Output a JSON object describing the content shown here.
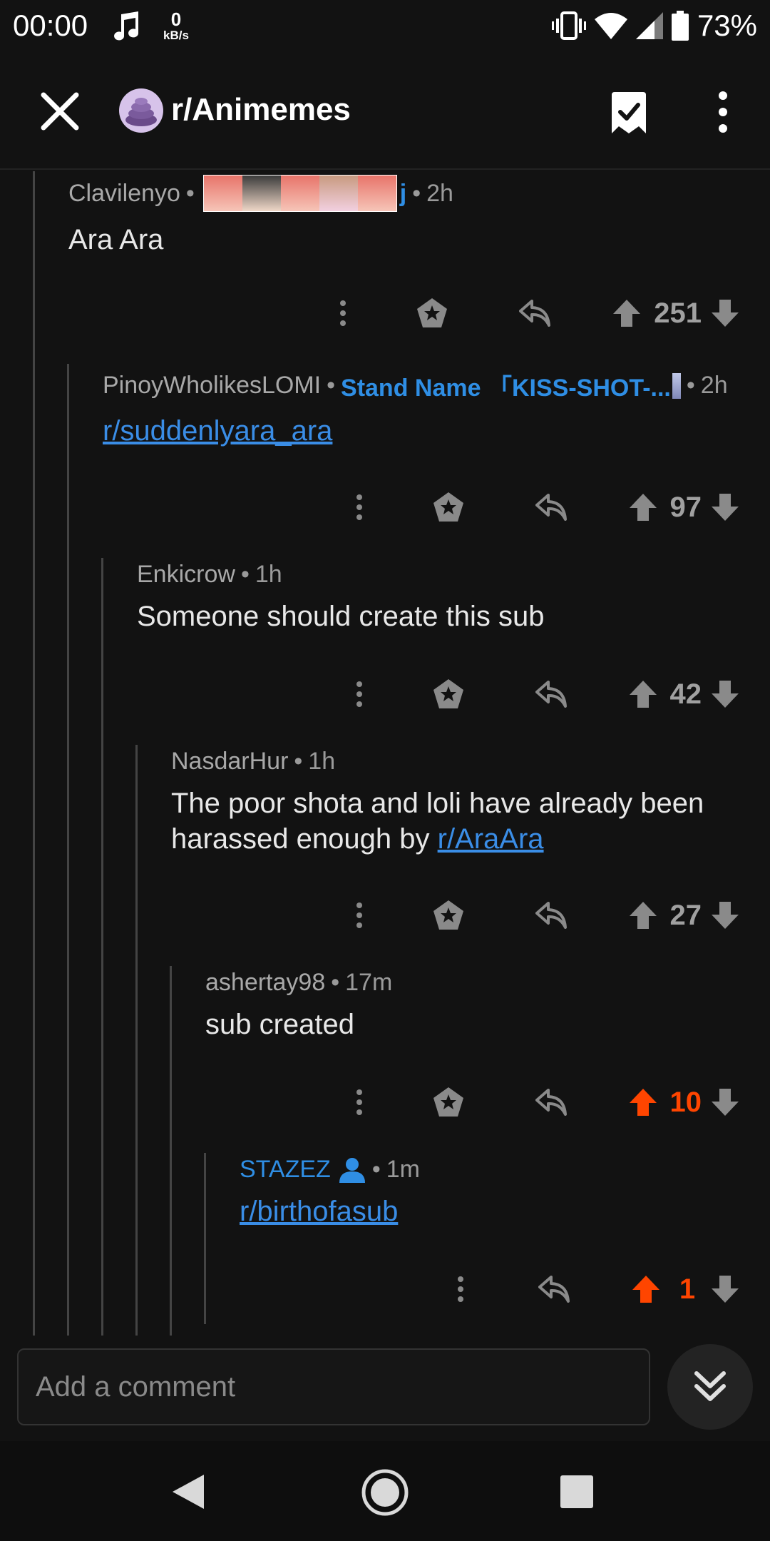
{
  "status_bar": {
    "time": "00:00",
    "net_speed_value": "0",
    "net_speed_unit": "kB/s",
    "battery": "73%"
  },
  "app_bar": {
    "title": "r/Animemes",
    "icons": [
      "close-icon",
      "subreddit-avatar",
      "saved-bookmark-icon",
      "more-vert-icon"
    ]
  },
  "comments": [
    {
      "user": "Clavilenyo",
      "flair": "",
      "flair_trail": "j",
      "time": "2h",
      "body": "Ara Ara",
      "link": "",
      "score": "251",
      "upvoted": false
    },
    {
      "user": "PinoyWholikesLOMI",
      "flair": "Stand Name 「KISS-SHOT-...",
      "flair_trail": "",
      "time": "2h",
      "body": "",
      "link": "r/suddenlyara_ara",
      "score": "97",
      "upvoted": false
    },
    {
      "user": "Enkicrow",
      "flair": "",
      "flair_trail": "",
      "time": "1h",
      "body": "Someone should create this sub",
      "link": "",
      "score": "42",
      "upvoted": false
    },
    {
      "user": "NasdarHur",
      "flair": "",
      "flair_trail": "",
      "time": "1h",
      "body": "The poor shota and loli have already been harassed enough by ",
      "link": "r/AraAra",
      "score": "27",
      "upvoted": false
    },
    {
      "user": "ashertay98",
      "flair": "",
      "flair_trail": "",
      "time": "17m",
      "body": "sub created",
      "link": "",
      "score": "10",
      "upvoted": true
    },
    {
      "user": "STAZEZ",
      "flair": "",
      "flair_trail": "",
      "time": "1m",
      "body": "",
      "link": "r/birthofasub",
      "score": "1",
      "upvoted": true
    }
  ],
  "comment_input": {
    "placeholder": "Add a comment"
  },
  "colors": {
    "background": "#121212",
    "upvote": "#ff4500",
    "link": "#3a8de6",
    "flair": "#2f8ee4"
  }
}
